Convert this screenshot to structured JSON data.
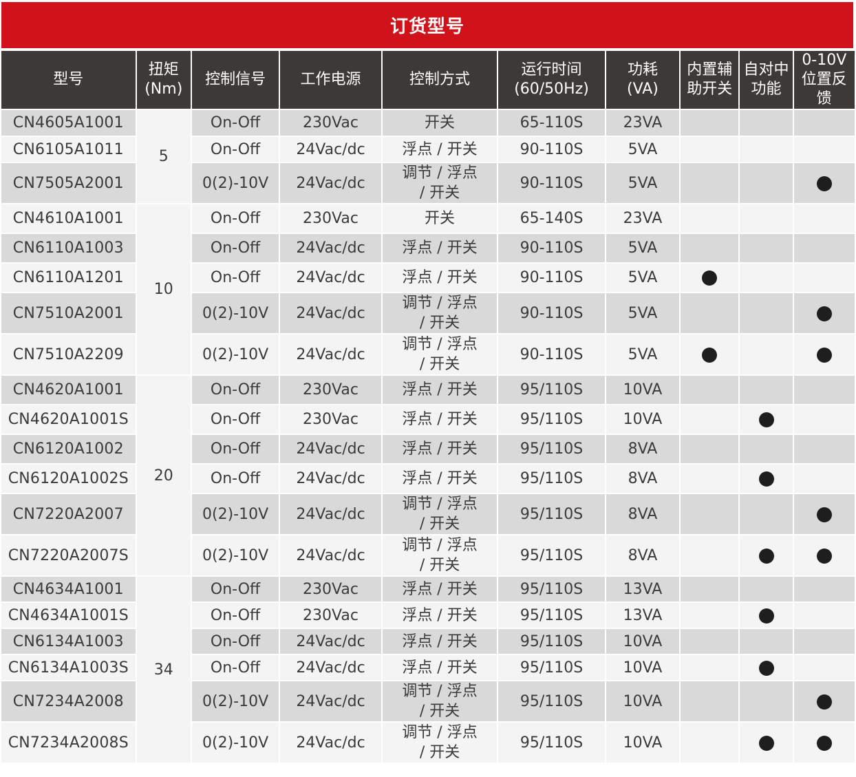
{
  "title": "订货型号",
  "colors": {
    "title_bg": "#d0121b",
    "header_bg": "#3d3937",
    "row_gray": "#d9d9d9",
    "row_white": "#f4f4f4",
    "dot": "#1e1e1e"
  },
  "headers": [
    "型号",
    "扭矩\n(Nm)",
    "控制信号",
    "工作电源",
    "控制方式",
    "运行时间\n(60/50Hz)",
    "功耗\n(VA)",
    "内置辅\n助开关",
    "自对中\n功能",
    "0-10V\n位置反\n馈"
  ],
  "torque_groups": [
    {
      "value": "5",
      "rows": 3
    },
    {
      "value": "10",
      "rows": 5
    },
    {
      "value": "20",
      "rows": 6
    },
    {
      "value": "34",
      "rows": 6
    }
  ],
  "rows": [
    {
      "model": "CN4605A1001",
      "signal": "On-Off",
      "power": "230Vac",
      "control": "开关",
      "runtime": "65-110S",
      "consumption": "23VA",
      "aux": false,
      "center": false,
      "feedback": false
    },
    {
      "model": "CN6105A1011",
      "signal": "On-Off",
      "power": "24Vac/dc",
      "control": "浮点 / 开关",
      "runtime": "90-110S",
      "consumption": "5VA",
      "aux": false,
      "center": false,
      "feedback": false
    },
    {
      "model": "CN7505A2001",
      "signal": "0(2)-10V",
      "power": "24Vac/dc",
      "control": "调节 / 浮点\n/ 开关",
      "runtime": "90-110S",
      "consumption": "5VA",
      "aux": false,
      "center": false,
      "feedback": true
    },
    {
      "model": "CN4610A1001",
      "signal": "On-Off",
      "power": "230Vac",
      "control": "开关",
      "runtime": "65-140S",
      "consumption": "23VA",
      "aux": false,
      "center": false,
      "feedback": false
    },
    {
      "model": "CN6110A1003",
      "signal": "On-Off",
      "power": "24Vac/dc",
      "control": "浮点 / 开关",
      "runtime": "90-110S",
      "consumption": "5VA",
      "aux": false,
      "center": false,
      "feedback": false
    },
    {
      "model": "CN6110A1201",
      "signal": "On-Off",
      "power": "24Vac/dc",
      "control": "浮点 / 开关",
      "runtime": "90-110S",
      "consumption": "5VA",
      "aux": true,
      "center": false,
      "feedback": false
    },
    {
      "model": "CN7510A2001",
      "signal": "0(2)-10V",
      "power": "24Vac/dc",
      "control": "调节 / 浮点\n/ 开关",
      "runtime": "90-110S",
      "consumption": "5VA",
      "aux": false,
      "center": false,
      "feedback": true
    },
    {
      "model": "CN7510A2209",
      "signal": "0(2)-10V",
      "power": "24Vac/dc",
      "control": "调节 / 浮点\n/ 开关",
      "runtime": "90-110S",
      "consumption": "5VA",
      "aux": true,
      "center": false,
      "feedback": true
    },
    {
      "model": "CN4620A1001",
      "signal": "On-Off",
      "power": "230Vac",
      "control": "浮点 / 开关",
      "runtime": "95/110S",
      "consumption": "10VA",
      "aux": false,
      "center": false,
      "feedback": false
    },
    {
      "model": "CN4620A1001S",
      "signal": "On-Off",
      "power": "230Vac",
      "control": "浮点 / 开关",
      "runtime": "95/110S",
      "consumption": "10VA",
      "aux": false,
      "center": true,
      "feedback": false
    },
    {
      "model": "CN6120A1002",
      "signal": "On-Off",
      "power": "24Vac/dc",
      "control": "浮点 / 开关",
      "runtime": "95/110S",
      "consumption": "8VA",
      "aux": false,
      "center": false,
      "feedback": false
    },
    {
      "model": "CN6120A1002S",
      "signal": "On-Off",
      "power": "24Vac/dc",
      "control": "浮点 / 开关",
      "runtime": "95/110S",
      "consumption": "8VA",
      "aux": false,
      "center": true,
      "feedback": false
    },
    {
      "model": "CN7220A2007",
      "signal": "0(2)-10V",
      "power": "24Vac/dc",
      "control": "调节 / 浮点\n/ 开关",
      "runtime": "95/110S",
      "consumption": "8VA",
      "aux": false,
      "center": false,
      "feedback": true
    },
    {
      "model": "CN7220A2007S",
      "signal": "0(2)-10V",
      "power": "24Vac/dc",
      "control": "调节 / 浮点\n/ 开关",
      "runtime": "95/110S",
      "consumption": "8VA",
      "aux": false,
      "center": true,
      "feedback": true
    },
    {
      "model": "CN4634A1001",
      "signal": "On-Off",
      "power": "230Vac",
      "control": "浮点 / 开关",
      "runtime": "95/110S",
      "consumption": "13VA",
      "aux": false,
      "center": false,
      "feedback": false
    },
    {
      "model": "CN4634A1001S",
      "signal": "On-Off",
      "power": "230Vac",
      "control": "浮点 / 开关",
      "runtime": "95/110S",
      "consumption": "13VA",
      "aux": false,
      "center": true,
      "feedback": false
    },
    {
      "model": "CN6134A1003",
      "signal": "On-Off",
      "power": "24Vac/dc",
      "control": "浮点 / 开关",
      "runtime": "95/110S",
      "consumption": "10VA",
      "aux": false,
      "center": false,
      "feedback": false
    },
    {
      "model": "CN6134A1003S",
      "signal": "On-Off",
      "power": "24Vac/dc",
      "control": "浮点 / 开关",
      "runtime": "95/110S",
      "consumption": "10VA",
      "aux": false,
      "center": true,
      "feedback": false
    },
    {
      "model": "CN7234A2008",
      "signal": "0(2)-10V",
      "power": "24Vac/dc",
      "control": "调节 / 浮点\n/ 开关",
      "runtime": "95/110S",
      "consumption": "10VA",
      "aux": false,
      "center": false,
      "feedback": true
    },
    {
      "model": "CN7234A2008S",
      "signal": "0(2)-10V",
      "power": "24Vac/dc",
      "control": "调节 / 浮点\n/ 开关",
      "runtime": "95/110S",
      "consumption": "10VA",
      "aux": false,
      "center": true,
      "feedback": true
    }
  ]
}
